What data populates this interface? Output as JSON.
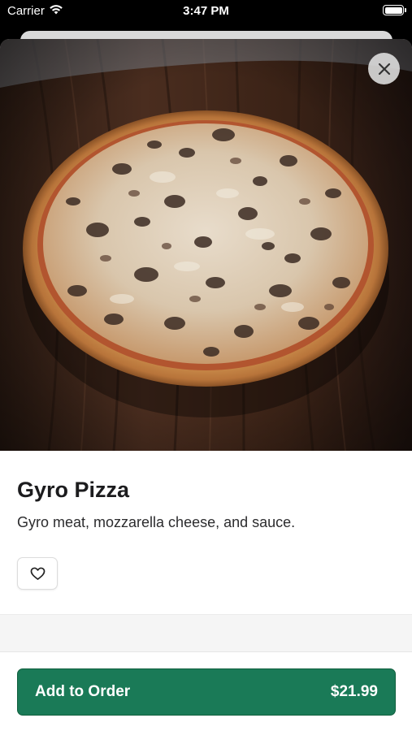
{
  "status_bar": {
    "carrier": "Carrier",
    "time": "3:47 PM",
    "battery_level": 1.0
  },
  "product": {
    "name": "Gyro Pizza",
    "description": "Gyro meat, mozzarella cheese, and sauce.",
    "image_icon": "pizza-photo"
  },
  "actions": {
    "close_icon": "close-icon",
    "favorite_icon": "heart-icon",
    "add_label": "Add to Order",
    "price": "$21.99"
  },
  "colors": {
    "accent": "#1a7a57",
    "background": "#ffffff"
  }
}
